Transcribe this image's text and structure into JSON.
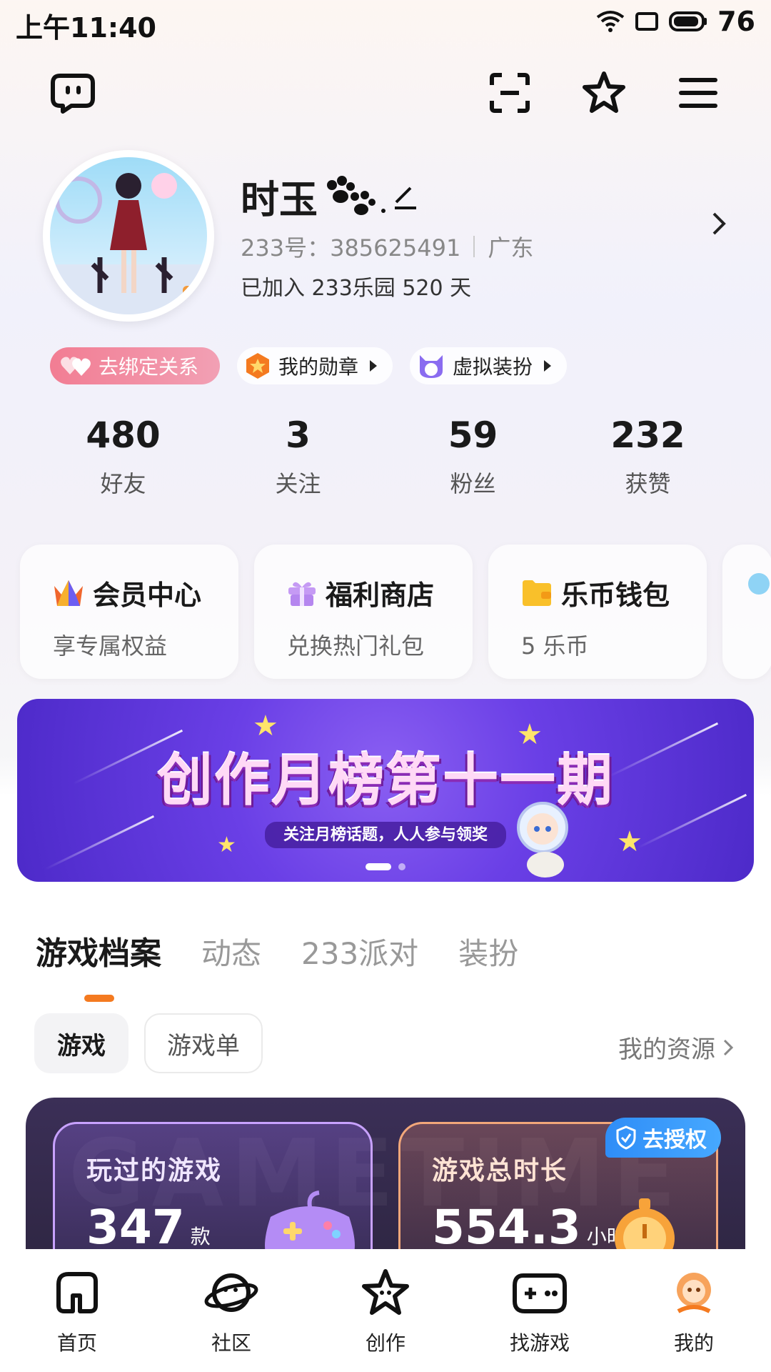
{
  "status": {
    "time": "上午11:40",
    "battery": "76"
  },
  "profile": {
    "name": "时玉",
    "id_text": "233号：385625491",
    "location": "广东",
    "joined": "已加入 233乐园 520 天"
  },
  "chips": [
    {
      "label": "去绑定关系"
    },
    {
      "label": "我的勋章"
    },
    {
      "label": "虚拟装扮"
    }
  ],
  "stats": [
    {
      "value": "480",
      "label": "好友"
    },
    {
      "value": "3",
      "label": "关注"
    },
    {
      "value": "59",
      "label": "粉丝"
    },
    {
      "value": "232",
      "label": "获赞"
    }
  ],
  "cards": [
    {
      "title": "会员中心",
      "sub": "享专属权益"
    },
    {
      "title": "福利商店",
      "sub": "兑换热门礼包"
    },
    {
      "title": "乐币钱包",
      "sub": "5 乐币"
    }
  ],
  "banner": {
    "title": "创作月榜第十一期",
    "subtitle": "关注月榜话题，人人参与领奖"
  },
  "tabs": [
    "游戏档案",
    "动态",
    "233派对",
    "装扮"
  ],
  "subtabs": [
    "游戏",
    "游戏单"
  ],
  "resources_link": "我的资源",
  "game_panel": {
    "played_label": "玩过的游戏",
    "played_value": "347",
    "played_unit": "款",
    "time_label": "游戏总时长",
    "time_value": "554.3",
    "time_unit": "小时",
    "auth_badge": "去授权"
  },
  "nav": [
    {
      "label": "首页"
    },
    {
      "label": "社区"
    },
    {
      "label": "创作"
    },
    {
      "label": "找游戏"
    },
    {
      "label": "我的"
    }
  ],
  "colors": {
    "accent": "#f47a20",
    "banner": "#6a3fe6",
    "auth": "#2f8df7"
  }
}
